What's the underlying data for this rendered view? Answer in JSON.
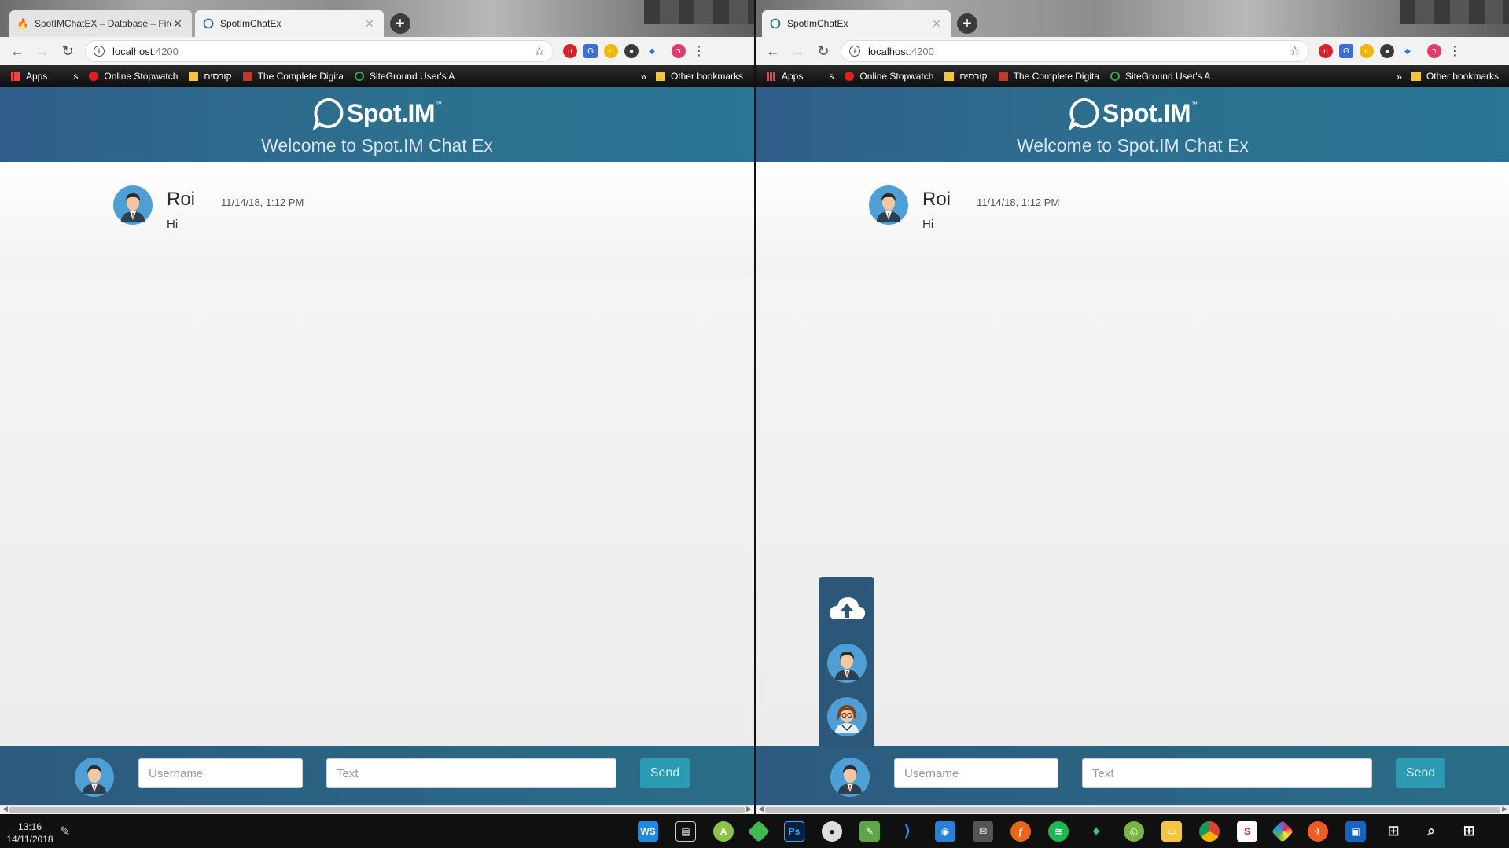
{
  "left_window": {
    "tabs": [
      {
        "label": "SpotIMChatEX – Database – Fireb",
        "favicon": "firebase-icon",
        "active": false
      },
      {
        "label": "SpotImChatEx",
        "favicon": "spotim-icon",
        "active": true
      }
    ],
    "address": {
      "host": "localhost",
      "port": ":4200"
    }
  },
  "right_window": {
    "tabs": [
      {
        "label": "SpotImChatEx",
        "favicon": "spotim-icon",
        "active": true
      }
    ],
    "address": {
      "host": "localhost",
      "port": ":4200"
    }
  },
  "bookmarks": {
    "apps": "Apps",
    "s": "s",
    "stopwatch": "Online Stopwatch",
    "hebrew_folder": "קורסים",
    "complete_digital": "The Complete Digita",
    "siteground": "SiteGround User's A",
    "more": "»",
    "other": "Other bookmarks"
  },
  "app": {
    "brand": "Spot.IM",
    "tm": "™",
    "welcome": "Welcome to Spot.IM Chat Ex",
    "messages": [
      {
        "user": "Roi",
        "time": "11/14/18, 1:12 PM",
        "text": "Hi"
      }
    ],
    "username_placeholder": "Username",
    "text_placeholder": "Text",
    "send_label": "Send"
  },
  "taskbar": {
    "time": "13:16",
    "date": "14/11/2018",
    "apps": [
      "webstorm-icon",
      "task-view-icon",
      "android-studio-icon",
      "git-icon",
      "photoshop-icon",
      "github-icon",
      "notepad-icon",
      "vscode-icon",
      "tool-icon",
      "mail-icon",
      "firefox-icon",
      "spotify-icon",
      "sourcetree-icon",
      "android-icon",
      "file-explorer-icon",
      "chrome-icon",
      "slack-icon",
      "ide-icon",
      "postman-icon",
      "app-icon",
      "taskview-icon",
      "search-icon",
      "windows-icon"
    ]
  },
  "colors": {
    "header": "#2d6f8e",
    "footer": "#2a6d86",
    "send": "#2a9bb3",
    "panel": "#2c5779"
  }
}
